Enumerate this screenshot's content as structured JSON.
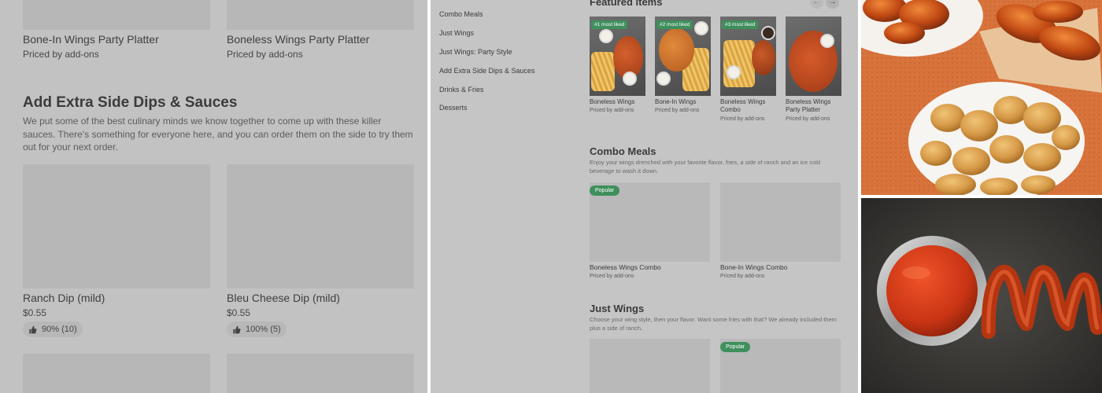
{
  "left_panel": {
    "top_cards": [
      {
        "title": "Bone-In Wings Party Platter",
        "subtitle": "Priced by add-ons"
      },
      {
        "title": "Boneless Wings Party Platter",
        "subtitle": "Priced by add-ons"
      }
    ],
    "section": {
      "heading": "Add Extra Side Dips & Sauces",
      "description": "We put some of the best culinary minds we know together to come up with these killer sauces. There's something for everyone here, and you can order them on the side to try them out for your next order."
    },
    "dips": [
      {
        "name": "Ranch Dip (mild)",
        "price": "$0.55",
        "rating": "90% (10)"
      },
      {
        "name": "Bleu Cheese Dip (mild)",
        "price": "$0.55",
        "rating": "100% (5)"
      }
    ]
  },
  "middle_panel": {
    "nav": [
      "Combo Meals",
      "Just Wings",
      "Just Wings: Party Style",
      "Add Extra Side Dips & Sauces",
      "Drinks & Fries",
      "Desserts"
    ],
    "featured": {
      "heading": "Featured items",
      "prev_icon": "←",
      "next_icon": "→",
      "items": [
        {
          "tag": "#1 most liked",
          "name": "Boneless Wings",
          "subtitle": "Priced by add-ons"
        },
        {
          "tag": "#2 most liked",
          "name": "Bone-In Wings",
          "subtitle": "Priced by add-ons"
        },
        {
          "tag": "#3 most liked",
          "name": "Boneless Wings Combo",
          "subtitle": "Priced by add-ons"
        },
        {
          "tag": "",
          "name": "Boneless Wings Party Platter",
          "subtitle": "Priced by add-ons"
        }
      ]
    },
    "combo": {
      "heading": "Combo Meals",
      "description": "Enjoy your wings drenched with your favorite flavor, fries, a side of ranch and an ice cold beverage to wash it down.",
      "popular_label": "Popular",
      "items": [
        {
          "name": "Boneless Wings Combo",
          "subtitle": "Priced by add-ons"
        },
        {
          "name": "Bone-In Wings Combo",
          "subtitle": "Priced by add-ons"
        }
      ]
    },
    "just_wings": {
      "heading": "Just Wings",
      "description": "Choose your wing style, then your flavor. Want some fries with that? We already included them plus a side of ranch.",
      "popular_label": "Popular"
    }
  },
  "colors": {
    "overlay_gray": "#c2c2c2",
    "tag_green": "#3f8f5c",
    "terracotta": "#d8733c"
  }
}
